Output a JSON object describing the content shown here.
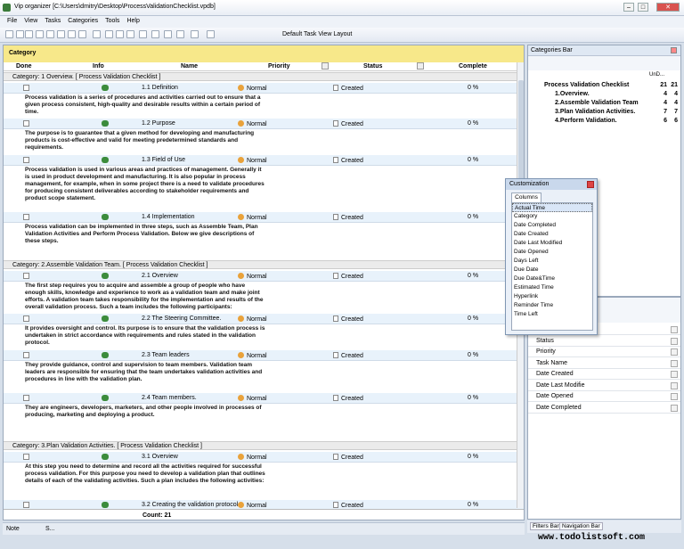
{
  "window": {
    "title": "Vip organizer [C:\\Users\\dmitry\\Desktop\\ProcessValidationChecklist.vpdb]"
  },
  "menu": [
    "File",
    "View",
    "Tasks",
    "Categories",
    "Tools",
    "Help"
  ],
  "toolbar": {
    "layout": "Default Task View Layout"
  },
  "grid": {
    "group_label": "Category",
    "columns": {
      "done": "Done",
      "info": "Info",
      "name": "Name",
      "priority": "Priority",
      "status": "Status",
      "complete": "Complete"
    },
    "categories": [
      {
        "label": "Category: 1 Overview.    [ Process Validation Checklist ]"
      },
      {
        "label": "Category: 2.Assemble Validation Team.    [ Process Validation Checklist ]"
      },
      {
        "label": "Category: 3.Plan Validation Activities.    [ Process Validation Checklist ]"
      }
    ],
    "tasks": [
      {
        "name": "1.1 Definition",
        "priority": "Normal",
        "status": "Created",
        "complete": "0 %",
        "desc": "Process validation is a series of procedures and activities carried out to ensure that a given process consistent, high-quality and desirable results within a certain period of time."
      },
      {
        "name": "1.2 Purpose",
        "priority": "Normal",
        "status": "Created",
        "complete": "0 %",
        "desc": "The purpose is to guarantee that a given method for developing and manufacturing products is cost-effective and valid for meeting predetermined standards and requirements."
      },
      {
        "name": "1.3 Field of Use",
        "priority": "Normal",
        "status": "Created",
        "complete": "0 %",
        "desc": "Process validation is used in various areas and practices of management. Generally it is used in product development and manufacturing. It is also popular in process management, for example, when in some project there is a need to validate procedures for producing consistent deliverables according to stakeholder requirements and product scope statement."
      },
      {
        "name": "1.4 Implementation",
        "priority": "Normal",
        "status": "Created",
        "complete": "0 %",
        "desc": "Process validation can be implemented in three steps, such as Assemble Team, Plan Validation Activities and Perform Process Validation. Below we give descriptions of these steps."
      },
      {
        "name": "2.1 Overview",
        "priority": "Normal",
        "status": "Created",
        "complete": "0 %",
        "desc": "The first step requires you to acquire and assemble a group of people who have enough skills, knowledge and experience to work as a validation team and make joint efforts. A validation team takes responsibility for the implementation and results of the overall validation process. Such a team includes the following participants:"
      },
      {
        "name": "2.2 The Steering Committee.",
        "priority": "Normal",
        "status": "Created",
        "complete": "0 %",
        "desc": "It provides oversight and control. Its purpose is to ensure that the validation process is undertaken in strict accordance with requirements and rules stated in the validation protocol."
      },
      {
        "name": "2.3 Team leaders",
        "priority": "Normal",
        "status": "Created",
        "complete": "0 %",
        "desc": "They provide guidance, control and supervision to team members. Validation team leaders are responsible for ensuring that the team undertakes validation activities and procedures in line with the validation plan."
      },
      {
        "name": "2.4 Team members.",
        "priority": "Normal",
        "status": "Created",
        "complete": "0 %",
        "desc": "They are engineers, developers, marketers, and other people involved in processes of producing, marketing and deploying a product."
      },
      {
        "name": "3.1 Overview",
        "priority": "Normal",
        "status": "Created",
        "complete": "0 %",
        "desc": "At this step you need to determine and record all the activities required for successful process validation. For this purpose you need to develop a validation plan that outlines details of each of the validating activities. Such a plan includes the following activities:"
      },
      {
        "name": "3.2 Creating the validation protocol",
        "priority": "Normal",
        "status": "Created",
        "complete": "0 %",
        "desc": ""
      }
    ],
    "count": "Count: 21"
  },
  "statusbar": {
    "note": "Note",
    "s": "S..."
  },
  "category_bar": {
    "title": "Categories Bar",
    "cols": "UnD...",
    "items": [
      {
        "label": "Process Validation Checklist",
        "n1": "21",
        "n2": "21"
      },
      {
        "label": "1.Overview.",
        "n1": "4",
        "n2": "4"
      },
      {
        "label": "2.Assemble Validation Team",
        "n1": "4",
        "n2": "4"
      },
      {
        "label": "3.Plan Validation Activities.",
        "n1": "7",
        "n2": "7"
      },
      {
        "label": "4.Perform Validation.",
        "n1": "6",
        "n2": "6"
      }
    ]
  },
  "customization": {
    "title": "Customization",
    "tab": "Columns",
    "items": [
      "Actual Time",
      "Category",
      "Date Completed",
      "Date Created",
      "Date Last Modified",
      "Date Opened",
      "Days Left",
      "Due Date",
      "Due Date&Time",
      "Estimated Time",
      "Hyperlink",
      "Reminder Time",
      "Time Left"
    ]
  },
  "filter_bar": {
    "rows": [
      "Due Date",
      "Status",
      "Priority",
      "Task Name",
      "Date Created",
      "Date Last Modifie",
      "Date Opened",
      "Date Completed"
    ]
  },
  "bottom_tabs": [
    "Filters Bar",
    "Navigation Bar"
  ],
  "watermark": "www.todolistsoft.com"
}
